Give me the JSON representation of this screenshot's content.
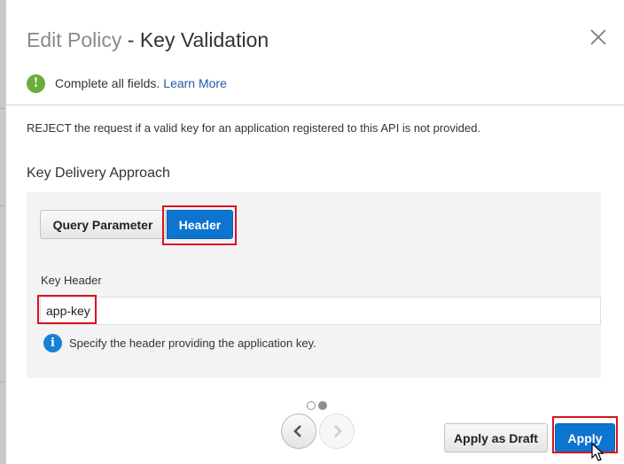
{
  "dialog": {
    "title_prefix": "Edit Policy",
    "title_separator": " - ",
    "title_main": "Key Validation",
    "close_icon": "close-icon"
  },
  "info": {
    "icon": "exclamation-icon",
    "message": "Complete all fields.",
    "link_text": "Learn More"
  },
  "description": "REJECT the request if a valid key for an application registered to this API is not provided.",
  "section": {
    "title": "Key Delivery Approach",
    "options": [
      {
        "label": "Query Parameter",
        "selected": false
      },
      {
        "label": "Header",
        "selected": true
      }
    ],
    "field_label": "Key Header",
    "field_value": "app-key",
    "hint_icon": "info-icon",
    "hint": "Specify the header providing the application key."
  },
  "pager": {
    "page_count": 2,
    "current_page": 2,
    "prev_icon": "chevron-left-icon",
    "next_icon": "chevron-right-icon"
  },
  "footer": {
    "draft_label": "Apply as Draft",
    "apply_label": "Apply"
  },
  "colors": {
    "accent": "#0d74d0",
    "highlight": "#d9141e",
    "success": "#6aad3c"
  }
}
